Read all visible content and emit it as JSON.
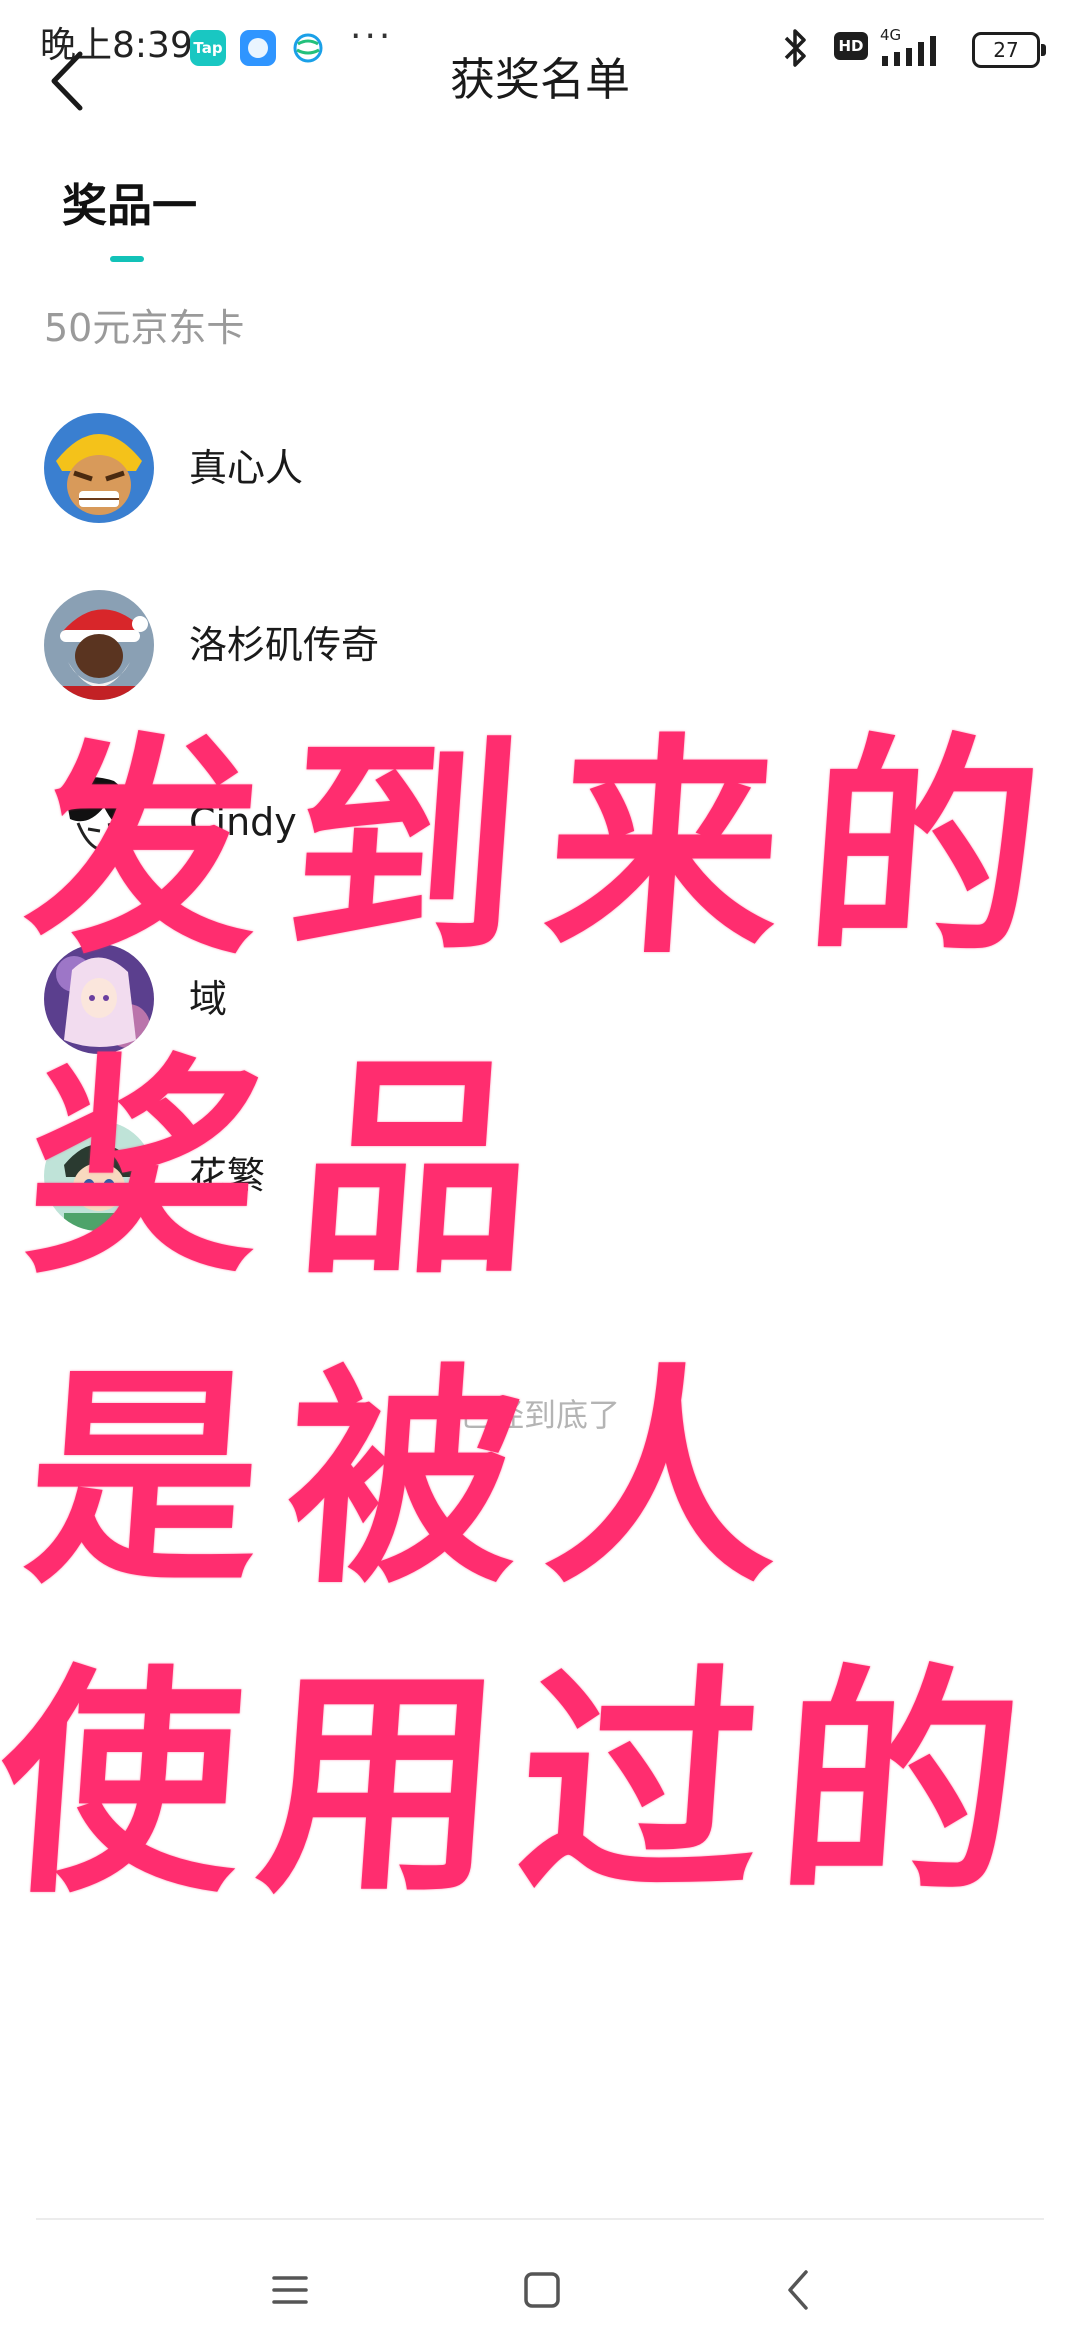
{
  "status_bar": {
    "time": "晚上8:39",
    "tap_icon_text": "Tap",
    "more_dots": "···",
    "hd_label": "HD",
    "network": "4G",
    "battery": "27"
  },
  "header": {
    "title": "获奖名单"
  },
  "tabs": [
    {
      "label": "奖品一",
      "active": true
    }
  ],
  "prize": {
    "name": "50元京东卡"
  },
  "winners": [
    {
      "name": "真心人"
    },
    {
      "name": "洛杉矶传奇"
    },
    {
      "name": "Cindy"
    },
    {
      "name": "域"
    },
    {
      "name": "花繁"
    }
  ],
  "end_text": "已经到底了",
  "overlay": {
    "line1": "发到来的",
    "line2": "奖品",
    "line3": "是被人",
    "line4": "使用过的",
    "color": "#ff2d6f"
  },
  "colors": {
    "accent": "#12c2b8"
  }
}
